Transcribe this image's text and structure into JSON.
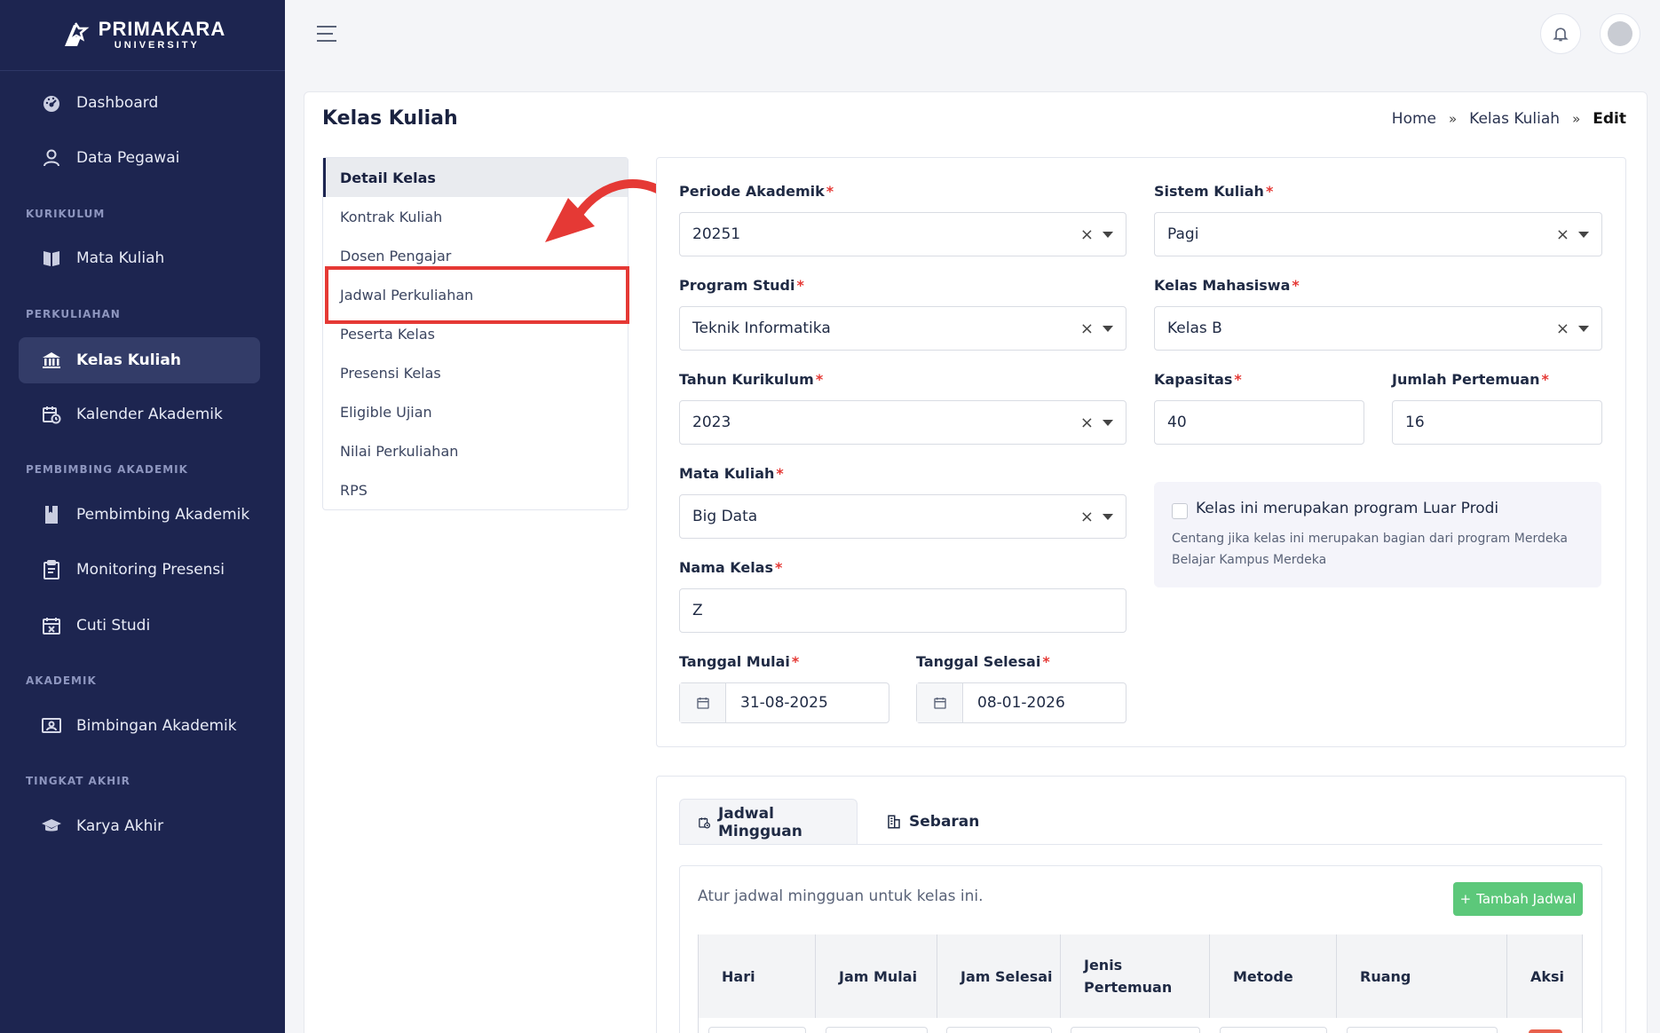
{
  "brand": {
    "name": "PRIMAKARA",
    "sub": "UNIVERSITY"
  },
  "sidebar": {
    "items": [
      {
        "label": "Dashboard",
        "icon": "dashboard-icon"
      },
      {
        "label": "Data Pegawai",
        "icon": "user-icon"
      },
      {
        "label": "Mata Kuliah",
        "icon": "book-icon"
      },
      {
        "label": "Kelas Kuliah",
        "icon": "institution-icon",
        "active": true
      },
      {
        "label": "Kalender Akademik",
        "icon": "calendar-clock-icon"
      },
      {
        "label": "Pembimbing Akademik",
        "icon": "bookmark-icon"
      },
      {
        "label": "Monitoring Presensi",
        "icon": "clipboard-icon"
      },
      {
        "label": "Cuti Studi",
        "icon": "calendar-x-icon"
      },
      {
        "label": "Bimbingan Akademik",
        "icon": "presentation-icon"
      },
      {
        "label": "Karya Akhir",
        "icon": "graduation-cap-icon"
      }
    ],
    "sections": [
      "KURIKULUM",
      "PERKULIAHAN",
      "PEMBIMBING AKADEMIK",
      "AKADEMIK",
      "TINGKAT AKHIR"
    ]
  },
  "page": {
    "title": "Kelas Kuliah"
  },
  "breadcrumb": {
    "home": "Home",
    "parent": "Kelas Kuliah",
    "current": "Edit",
    "sep": "»"
  },
  "section_menu": [
    "Detail Kelas",
    "Kontrak Kuliah",
    "Dosen Pengajar",
    "Jadwal Perkuliahan",
    "Peserta Kelas",
    "Presensi Kelas",
    "Eligible Ujian",
    "Nilai Perkuliahan",
    "RPS"
  ],
  "form": {
    "periode": {
      "label": "Periode Akademik",
      "value": "20251"
    },
    "sistem": {
      "label": "Sistem Kuliah",
      "value": "Pagi"
    },
    "prodi": {
      "label": "Program Studi",
      "value": "Teknik Informatika"
    },
    "kelas_mhs": {
      "label": "Kelas Mahasiswa",
      "value": "Kelas B"
    },
    "tahun": {
      "label": "Tahun Kurikulum",
      "value": "2023"
    },
    "kapasitas": {
      "label": "Kapasitas",
      "value": "40"
    },
    "jumlah": {
      "label": "Jumlah Pertemuan",
      "value": "16"
    },
    "matkul": {
      "label": "Mata Kuliah",
      "value": "Big Data"
    },
    "nama": {
      "label": "Nama Kelas",
      "value": "Z"
    },
    "mulai": {
      "label": "Tanggal Mulai",
      "value": "31-08-2025"
    },
    "selesai": {
      "label": "Tanggal Selesai",
      "value": "08-01-2026"
    },
    "required_mark": "*",
    "clear_mark": "×",
    "luar": {
      "title": "Kelas ini merupakan program Luar Prodi",
      "desc": "Centang jika kelas ini merupakan bagian dari program Merdeka Belajar Kampus Merdeka"
    }
  },
  "schedule": {
    "tabs": [
      "Jadwal Mingguan",
      "Sebaran"
    ],
    "desc": "Atur jadwal mingguan untuk kelas ini.",
    "add_label": "Tambah Jadwal",
    "add_plus": "+",
    "columns": [
      "Hari",
      "Jam Mulai",
      "Jam Selesai",
      "Jenis Pertemuan",
      "Metode",
      "Ruang",
      "Aksi"
    ]
  },
  "colors": {
    "sidebar": "#1d2550",
    "accent_red": "#e53935",
    "success": "#5cc87a"
  }
}
